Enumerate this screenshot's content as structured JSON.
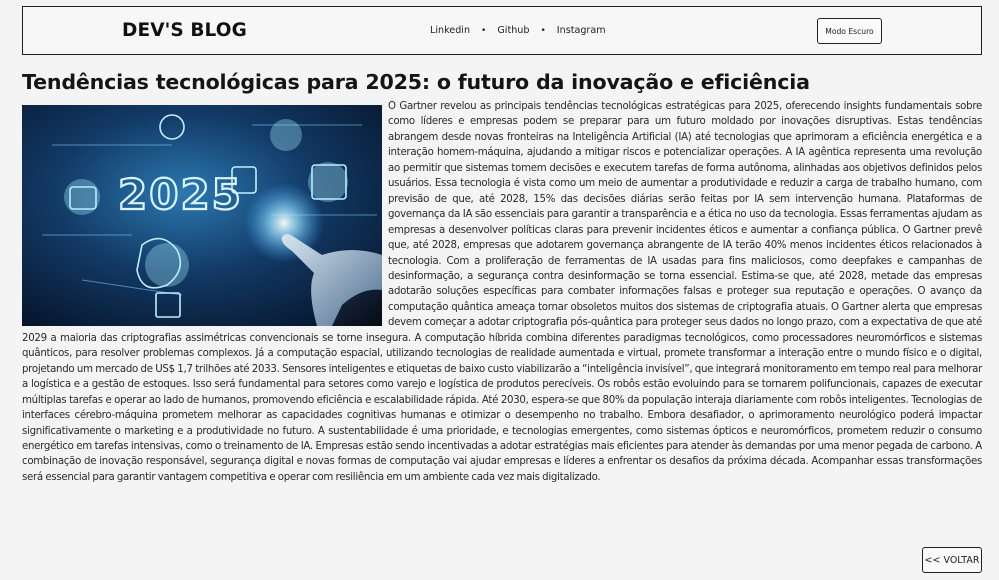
{
  "header": {
    "brand": "DEV'S BLOG",
    "nav": [
      {
        "label": "Linkedin"
      },
      {
        "label": "Github"
      },
      {
        "label": "Instagram"
      }
    ],
    "separator": "•",
    "dark_mode_label": "Modo Escuro"
  },
  "article": {
    "title": "Tendências tecnológicas para 2025: o futuro da inovação e eficiência",
    "image_text": "2025",
    "body": "O Gartner revelou as principais tendências tecnológicas estratégicas para 2025, oferecendo insights fundamentais sobre como líderes e empresas podem se preparar para um futuro moldado por inovações disruptivas. Estas tendências abrangem desde novas fronteiras na Inteligência Artificial (IA) até tecnologias que aprimoram a eficiência energética e a interação homem-máquina, ajudando a mitigar riscos e potencializar operações. A IA agêntica representa uma revolução ao permitir que sistemas tomem decisões e executem tarefas de forma autônoma, alinhadas aos objetivos definidos pelos usuários. Essa tecnologia é vista como um meio de aumentar a produtividade e reduzir a carga de trabalho humano, com previsão de que, até 2028, 15% das decisões diárias serão feitas por IA sem intervenção humana. Plataformas de governança da IA são essenciais para garantir a transparência e a ética no uso da tecnologia. Essas ferramentas ajudam as empresas a desenvolver políticas claras para prevenir incidentes éticos e aumentar a confiança pública. O Gartner prevê que, até 2028, empresas que adotarem governança abrangente de IA terão 40% menos incidentes éticos relacionados à tecnologia. Com a proliferação de ferramentas de IA usadas para fins maliciosos, como deepfakes e campanhas de desinformação, a segurança contra desinformação se torna essencial. Estima-se que, até 2028, metade das empresas adotarão soluções específicas para combater informações falsas e proteger sua reputação e operações. O avanço da computação quântica ameaça tornar obsoletos muitos dos sistemas de criptografia atuais. O Gartner alerta que empresas devem começar a adotar criptografia pós-quântica para proteger seus dados no longo prazo, com a expectativa de que até 2029 a maioria das criptografias assimétricas convencionais se torne insegura. A computação híbrida combina diferentes paradigmas tecnológicos, como processadores neuromórficos e sistemas quânticos, para resolver problemas complexos. Já a computação espacial, utilizando tecnologias de realidade aumentada e virtual, promete transformar a interação entre o mundo físico e o digital, projetando um mercado de US$ 1,7 trilhões até 2033. Sensores inteligentes e etiquetas de baixo custo viabilizarão a “inteligência invisível”, que integrará monitoramento em tempo real para melhorar a logística e a gestão de estoques. Isso será fundamental para setores como varejo e logística de produtos perecíveis. Os robôs estão evoluindo para se tornarem polifuncionais, capazes de executar múltiplas tarefas e operar ao lado de humanos, promovendo eficiência e escalabilidade rápida. Até 2030, espera-se que 80% da população interaja diariamente com robôs inteligentes. Tecnologias de interfaces cérebro-máquina prometem melhorar as capacidades cognitivas humanas e otimizar o desempenho no trabalho. Embora desafiador, o aprimoramento neurológico poderá impactar significativamente o marketing e a produtividade no futuro. A sustentabilidade é uma prioridade, e tecnologias emergentes, como sistemas ópticos e neuromórficos, prometem reduzir o consumo energético em tarefas intensivas, como o treinamento de IA. Empresas estão sendo incentivadas a adotar estratégias mais eficientes para atender às demandas por uma menor pegada de carbono. A combinação de inovação responsável, segurança digital e novas formas de computação vai ajudar empresas e líderes a enfrentar os desafios da próxima década. Acompanhar essas transformações será essencial para garantir vantagem competitiva e operar com resiliência em um ambiente cada vez mais digitalizado."
  },
  "back_label": "<< VOLTAR",
  "colors": {
    "background": "#f4f4f5",
    "border": "#222222",
    "text": "#1b1b1b",
    "image_dark": "#0a1d3a",
    "image_glow": "#6fd0ff"
  }
}
